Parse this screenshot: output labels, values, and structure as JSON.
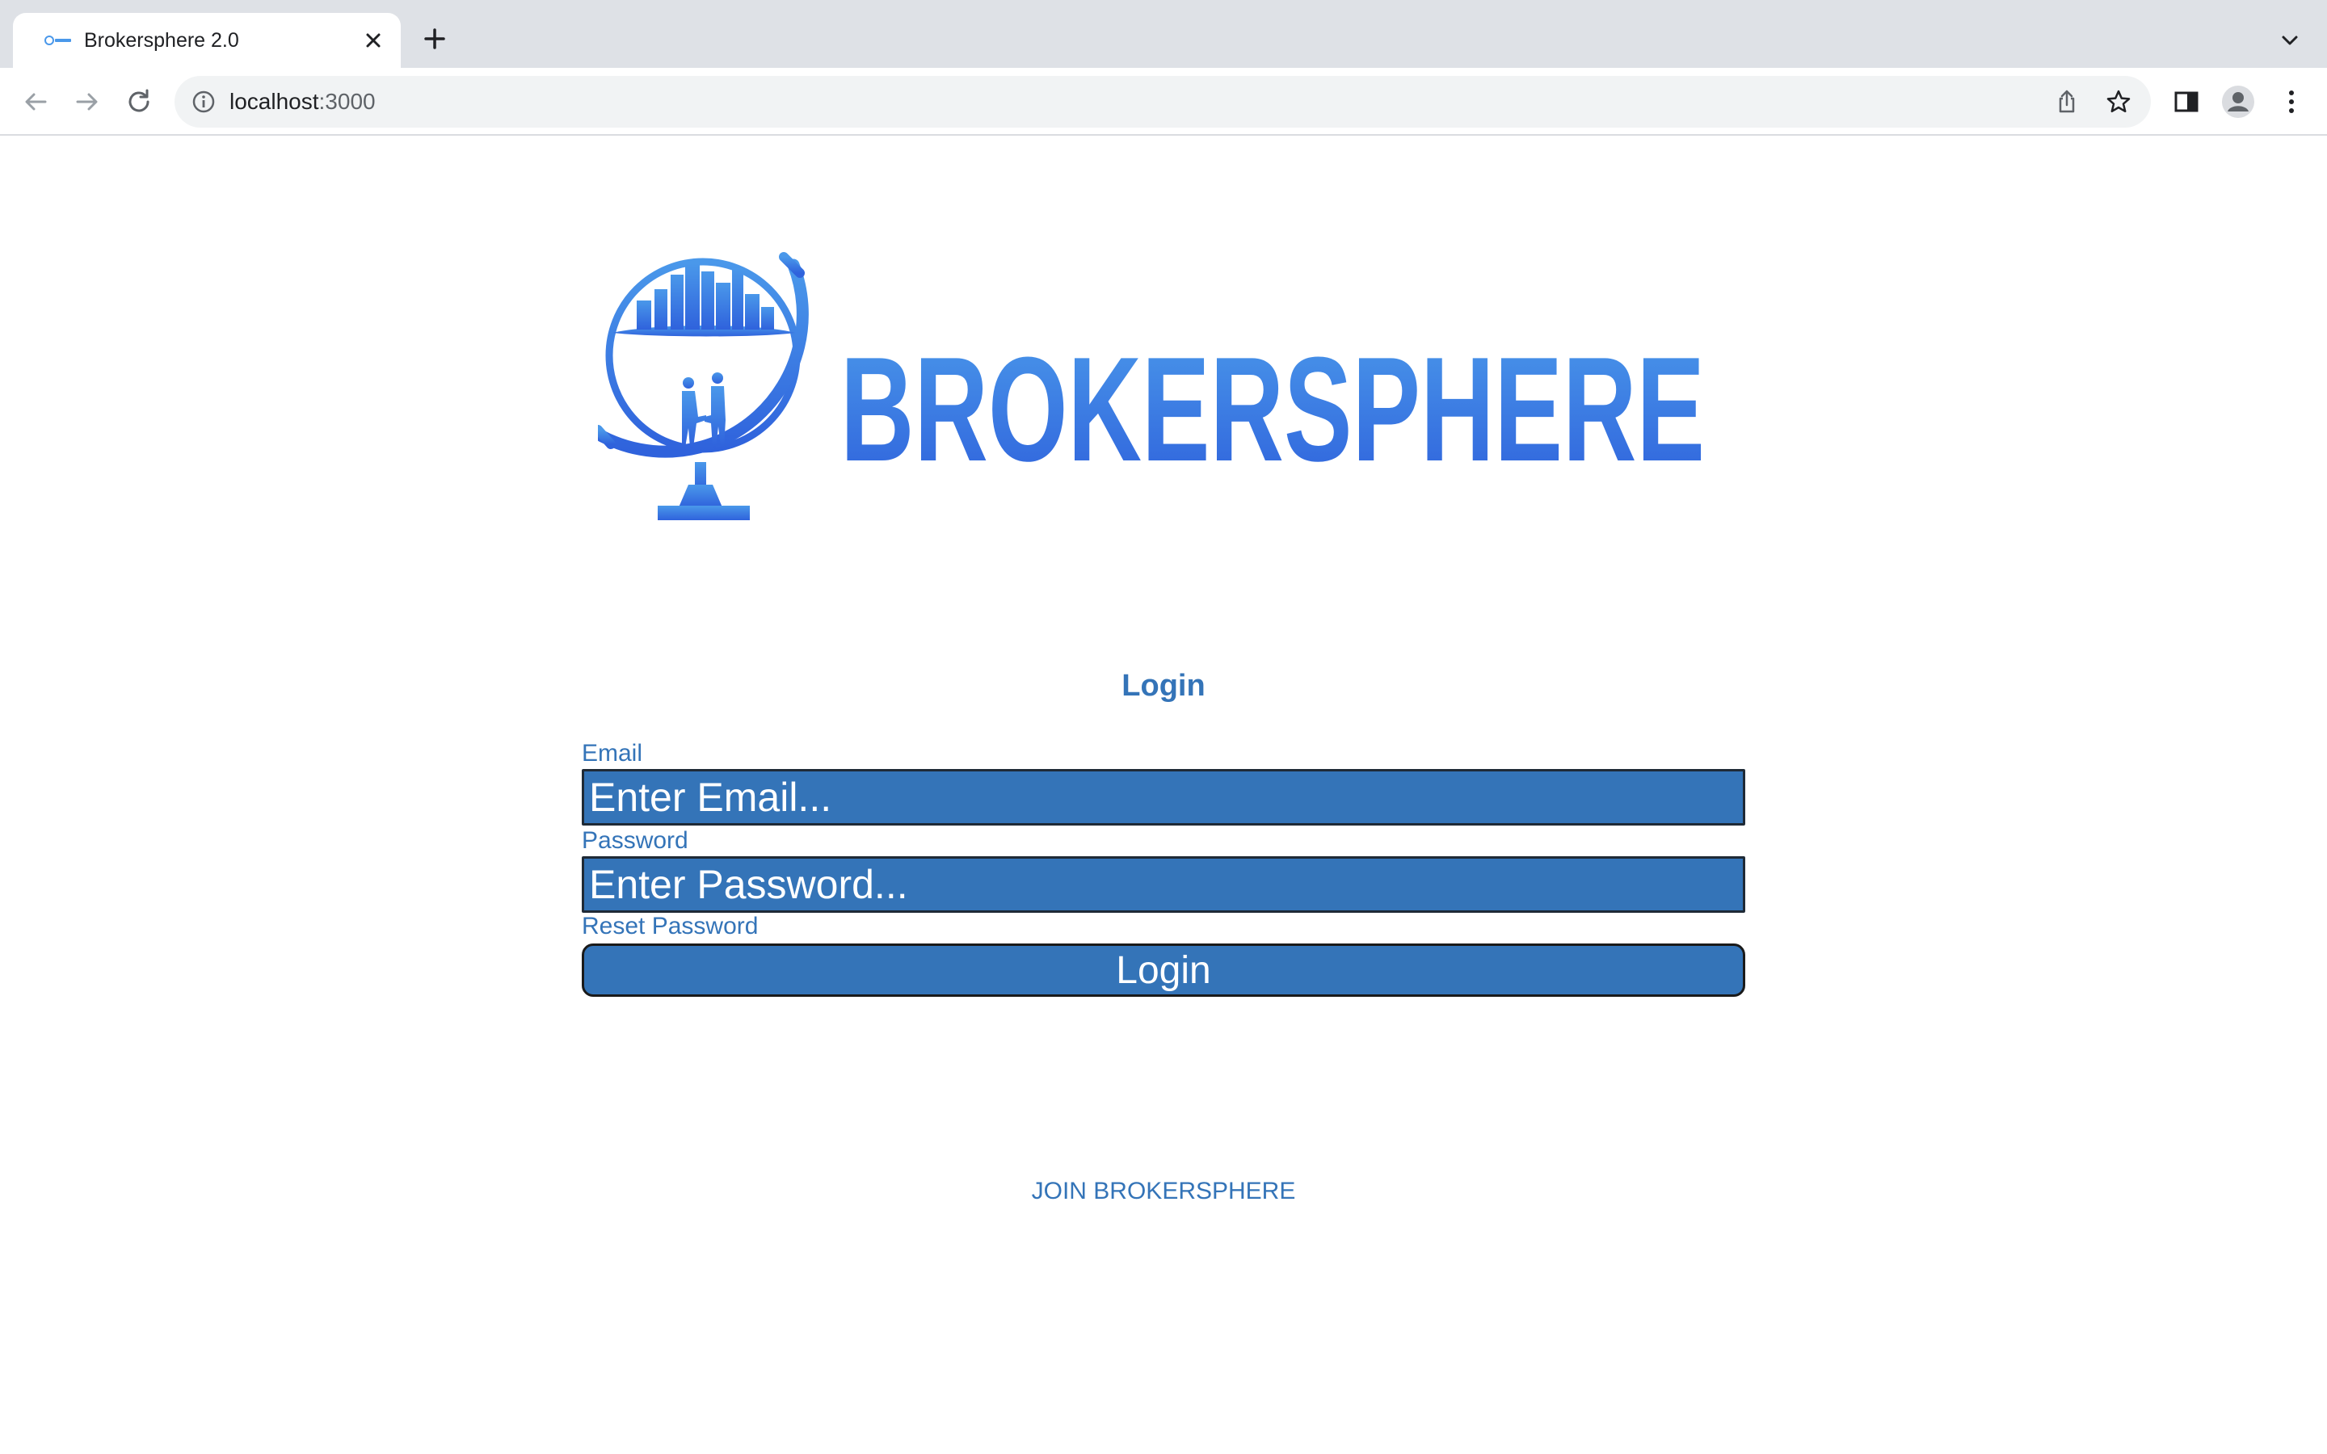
{
  "browser": {
    "tab": {
      "title": "Brokersphere 2.0",
      "favicon": "brokersphere-favicon"
    },
    "address": {
      "host": "localhost",
      "port": ":3000"
    },
    "icons": {
      "back": "back-arrow-icon",
      "forward": "forward-arrow-icon",
      "reload": "reload-icon",
      "info": "info-icon",
      "share": "share-icon",
      "bookmark": "star-icon",
      "side_panel": "side-panel-icon",
      "profile": "profile-icon",
      "menu": "kebab-menu-icon",
      "new_tab": "plus-icon",
      "close_tab": "close-icon",
      "tab_search": "chevron-down-icon"
    }
  },
  "brand": {
    "name": "BROKERSPHERE",
    "colors": {
      "logo_light": "#4a98ea",
      "logo_dark": "#2f62dc"
    }
  },
  "login": {
    "heading": "Login",
    "email": {
      "label": "Email",
      "placeholder": "Enter Email..."
    },
    "password": {
      "label": "Password",
      "placeholder": "Enter Password..."
    },
    "reset_label": "Reset Password",
    "submit_label": "Login",
    "join_label": "JOIN BROKERSPHERE"
  },
  "theme": {
    "accent": "#3474b8",
    "input_text": "#ffffff"
  }
}
